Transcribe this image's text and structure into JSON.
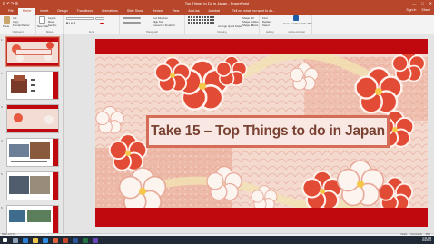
{
  "window": {
    "title": "Top Things to Do in Japan - PowerPoint",
    "quick_access": "⊡ ↶ ↷ ⊞",
    "controls": [
      "—",
      "□",
      "✕"
    ]
  },
  "ribbon_tabs": [
    "File",
    "Home",
    "Insert",
    "Design",
    "Transitions",
    "Animations",
    "Slide Show",
    "Review",
    "View",
    "Add-ins",
    "Acrobat"
  ],
  "tell_me": "Tell me what you want to do...",
  "account": {
    "sign_in": "Sign in",
    "share": "Share"
  },
  "ribbon": {
    "clipboard": {
      "label": "Clipboard",
      "paste": "Paste",
      "cut": "Cut",
      "copy": "Copy",
      "format_painter": "Format Painter"
    },
    "slides": {
      "label": "Slides",
      "new_slide": "New Slide",
      "layout": "Layout",
      "reset": "Reset",
      "section": "Section"
    },
    "font": {
      "label": "Font"
    },
    "paragraph": {
      "label": "Paragraph",
      "text_direction": "Text Direction",
      "align_text": "Align Text",
      "smartart": "Convert to SmartArt"
    },
    "drawing": {
      "label": "Drawing",
      "arrange": "Arrange",
      "quick_styles": "Quick Styles",
      "shape_fill": "Shape Fill",
      "shape_outline": "Shape Outline",
      "shape_effects": "Shape Effects"
    },
    "editing": {
      "label": "Editing",
      "find": "Find",
      "replace": "Replace",
      "select": "Select"
    },
    "adobe": {
      "label": "Adobe Acrobat",
      "create_share": "Create and Share Adobe PDF"
    }
  },
  "thumbnails": [
    {
      "num": "1"
    },
    {
      "num": "2"
    },
    {
      "num": "3"
    },
    {
      "num": "4"
    },
    {
      "num": "5"
    },
    {
      "num": "6"
    }
  ],
  "slide": {
    "title": "Take 15 – Top Things to do in Japan"
  },
  "status": {
    "slide_indicator": "Slide 1 of 17",
    "notes": "Notes",
    "comments": "Comments",
    "zoom": "65%"
  },
  "taskbar": {
    "time": "3:34 PM",
    "date": "9/4/2019"
  },
  "colors": {
    "accent": "#b7472a",
    "slide_band": "#c0090f",
    "title_frame": "#d56c58",
    "title_text": "#7a4233"
  }
}
